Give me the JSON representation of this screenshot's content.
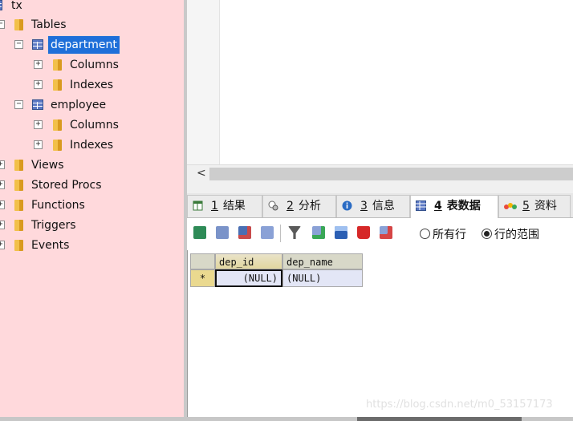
{
  "tree": {
    "root": "tx",
    "tables_label": "Tables",
    "department": {
      "label": "department",
      "columns": "Columns",
      "indexes": "Indexes"
    },
    "employee": {
      "label": "employee",
      "columns": "Columns",
      "indexes": "Indexes"
    },
    "views": "Views",
    "stored_procs": "Stored Procs",
    "functions": "Functions",
    "triggers": "Triggers",
    "events": "Events"
  },
  "scroll_arrow": "<",
  "tabs": [
    {
      "num": "1",
      "label": "结果",
      "icon": "result-table-icon"
    },
    {
      "num": "2",
      "label": "分析",
      "icon": "analysis-icon"
    },
    {
      "num": "3",
      "label": "信息",
      "icon": "info-icon"
    },
    {
      "num": "4",
      "label": "表数据",
      "icon": "table-data-icon",
      "active": true
    },
    {
      "num": "5",
      "label": "资料",
      "icon": "profile-icon"
    }
  ],
  "toolbar": {
    "icons": [
      "import-icon",
      "add-row-icon",
      "copy-row-icon",
      "paste-row-icon",
      "filter-icon",
      "insert-icon",
      "save-icon",
      "delete-icon",
      "cancel-icon"
    ],
    "radio_all": "所有行",
    "radio_range": "行的范围",
    "selected": "range"
  },
  "grid": {
    "columns": [
      "dep_id",
      "dep_name"
    ],
    "row_marker": "*",
    "rows": [
      [
        "(NULL)",
        "(NULL)"
      ]
    ]
  },
  "watermark": "https://blog.csdn.net/m0_53157173",
  "colors": {
    "tree_bg": "#ffd9dc",
    "selection": "#1e6fd9",
    "cell_bg": "#e3e6f6"
  }
}
